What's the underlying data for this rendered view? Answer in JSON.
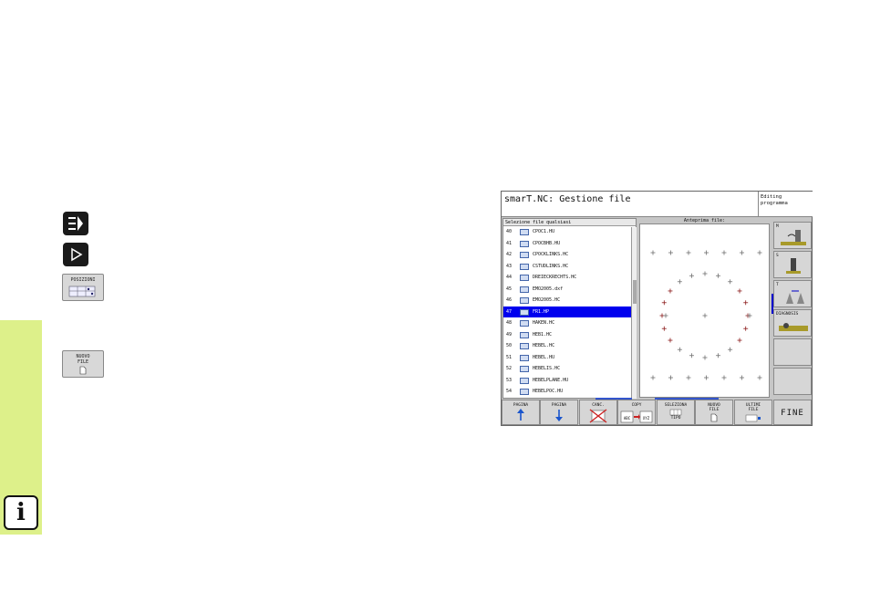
{
  "screen": {
    "title": "smarT.NC: Gestione file",
    "mode": [
      "Editing",
      "programma"
    ],
    "list_title": "Selezione file qualsiasi",
    "preview_title": "Anteprima file:",
    "files": [
      {
        "num": "40",
        "name": "CPOC1.HU"
      },
      {
        "num": "41",
        "name": "CPOCBHB.HU"
      },
      {
        "num": "42",
        "name": "CPOCKLINKS.HC"
      },
      {
        "num": "43",
        "name": "CSTUDLINKS.HC"
      },
      {
        "num": "44",
        "name": "DREIECKRECHTS.HC"
      },
      {
        "num": "45",
        "name": "EMO2005.dxf"
      },
      {
        "num": "46",
        "name": "EMO2005.HC"
      },
      {
        "num": "47",
        "name": "FR1.HP",
        "selected": true
      },
      {
        "num": "48",
        "name": "HAKEN.HC"
      },
      {
        "num": "49",
        "name": "HEB1.HC"
      },
      {
        "num": "50",
        "name": "HEBEL.HC"
      },
      {
        "num": "51",
        "name": "HEBEL.HU"
      },
      {
        "num": "52",
        "name": "HEBELIS.HC"
      },
      {
        "num": "53",
        "name": "HEBELPLANE.HU"
      },
      {
        "num": "54",
        "name": "HEBELPOC.HU"
      }
    ],
    "side_buttons": [
      {
        "label": "M",
        "icon": "spindle-icon"
      },
      {
        "label": "S",
        "icon": "tool-icon"
      },
      {
        "label": "T",
        "icon": "tool-change-icon"
      },
      {
        "label": "DIAGNOSIS",
        "icon": "diagnosis-icon"
      },
      {
        "label": "",
        "icon": ""
      },
      {
        "label": "",
        "icon": ""
      }
    ],
    "softkeys": [
      {
        "line1": "PAGINA",
        "line2": "",
        "icon": "arrow-up-icon"
      },
      {
        "line1": "PAGINA",
        "line2": "",
        "icon": "arrow-down-icon"
      },
      {
        "line1": "CANC.",
        "line2": "",
        "icon": "delete-icon"
      },
      {
        "line1": "COPY",
        "line2": "",
        "icon": "copy-icon"
      },
      {
        "line1": "SELEZIONA",
        "line2": "TIPO",
        "icon": "select-type-icon"
      },
      {
        "line1": "NUOVO",
        "line2": "FILE",
        "icon": "new-file-icon"
      },
      {
        "line1": "ULTIMI",
        "line2": "FILE",
        "icon": "recent-files-icon"
      },
      {
        "line1": "FINE",
        "line2": "",
        "icon": ""
      }
    ],
    "copy_labels": [
      "ABC",
      "XYZ"
    ]
  },
  "manual_keys": {
    "posizioni_label": "POSIZIONI",
    "nuovo_line1": "NUOVO",
    "nuovo_line2": "FILE"
  },
  "info_glyph": "i",
  "colors": {
    "selection": "#0000ee",
    "sidebar_green": "#ddf08a",
    "preview_point_red": "#8b1a1a",
    "preview_point_gray": "#707070"
  }
}
